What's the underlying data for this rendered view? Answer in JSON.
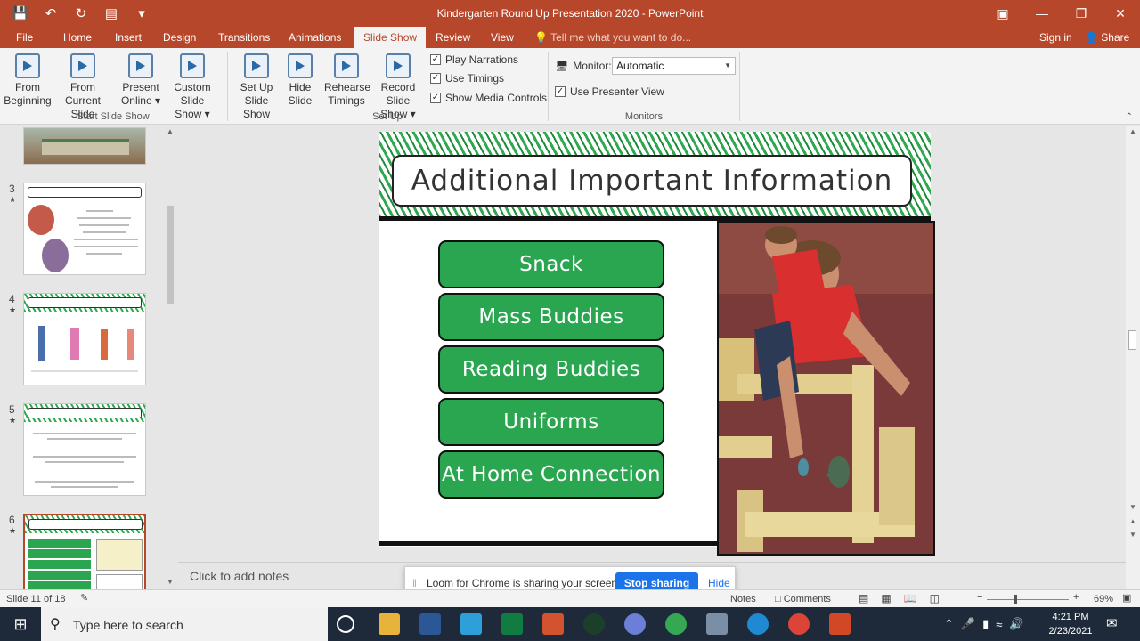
{
  "app": {
    "window_title": "Kindergarten Round Up Presentation 2020 - PowerPoint",
    "accent": "#b7472a"
  },
  "tabs": [
    "File",
    "Home",
    "Insert",
    "Design",
    "Transitions",
    "Animations",
    "Slide Show",
    "Review",
    "View"
  ],
  "active_tab": "Slide Show",
  "tell_me": "Tell me what you want to do...",
  "account": {
    "sign_in": "Sign in",
    "share": "Share"
  },
  "ribbon": {
    "start_group": {
      "label": "Start Slide Show",
      "from_beginning": [
        "From",
        "Beginning"
      ],
      "from_current": [
        "From",
        "Current Slide"
      ],
      "present_online": [
        "Present",
        "Online"
      ],
      "custom_show": [
        "Custom Slide",
        "Show"
      ]
    },
    "setup_group": {
      "label": "Set Up",
      "setup_show": [
        "Set Up",
        "Slide Show"
      ],
      "hide_slide": [
        "Hide",
        "Slide"
      ],
      "rehearse": [
        "Rehearse",
        "Timings"
      ],
      "record": [
        "Record Slide",
        "Show"
      ],
      "play_narrations": "Play Narrations",
      "use_timings": "Use Timings",
      "show_media_controls": "Show Media Controls"
    },
    "monitors_group": {
      "label": "Monitors",
      "monitor_label": "Monitor:",
      "monitor_value": "Automatic",
      "use_presenter_view": "Use Presenter View"
    }
  },
  "thumbnails": [
    "3",
    "4",
    "5",
    "6"
  ],
  "slide": {
    "title": "Additional Important Information",
    "buttons": [
      "Snack",
      "Mass Buddies",
      "Reading Buddies",
      "Uniforms",
      "At Home Connection"
    ],
    "button_color": "#2aa651"
  },
  "notes_placeholder": "Click to add notes",
  "loom": {
    "message": "Loom for Chrome is sharing your screen.",
    "stop": "Stop sharing",
    "hide": "Hide"
  },
  "status": {
    "slide_info": "Slide 11 of 18",
    "notes": "Notes",
    "comments": "Comments",
    "zoom": "69%"
  },
  "taskbar": {
    "search_placeholder": "Type here to search",
    "time": "4:21 PM",
    "date": "2/23/2021"
  }
}
